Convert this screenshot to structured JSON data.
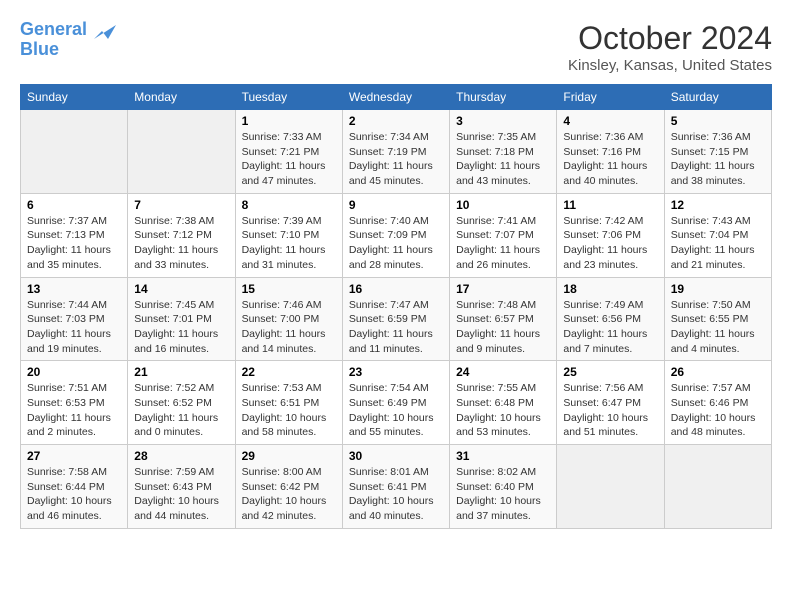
{
  "header": {
    "logo_line1": "General",
    "logo_line2": "Blue",
    "title": "October 2024",
    "subtitle": "Kinsley, Kansas, United States"
  },
  "days_of_week": [
    "Sunday",
    "Monday",
    "Tuesday",
    "Wednesday",
    "Thursday",
    "Friday",
    "Saturday"
  ],
  "weeks": [
    [
      {
        "day": "",
        "info": ""
      },
      {
        "day": "",
        "info": ""
      },
      {
        "day": "1",
        "info": "Sunrise: 7:33 AM\nSunset: 7:21 PM\nDaylight: 11 hours and 47 minutes."
      },
      {
        "day": "2",
        "info": "Sunrise: 7:34 AM\nSunset: 7:19 PM\nDaylight: 11 hours and 45 minutes."
      },
      {
        "day": "3",
        "info": "Sunrise: 7:35 AM\nSunset: 7:18 PM\nDaylight: 11 hours and 43 minutes."
      },
      {
        "day": "4",
        "info": "Sunrise: 7:36 AM\nSunset: 7:16 PM\nDaylight: 11 hours and 40 minutes."
      },
      {
        "day": "5",
        "info": "Sunrise: 7:36 AM\nSunset: 7:15 PM\nDaylight: 11 hours and 38 minutes."
      }
    ],
    [
      {
        "day": "6",
        "info": "Sunrise: 7:37 AM\nSunset: 7:13 PM\nDaylight: 11 hours and 35 minutes."
      },
      {
        "day": "7",
        "info": "Sunrise: 7:38 AM\nSunset: 7:12 PM\nDaylight: 11 hours and 33 minutes."
      },
      {
        "day": "8",
        "info": "Sunrise: 7:39 AM\nSunset: 7:10 PM\nDaylight: 11 hours and 31 minutes."
      },
      {
        "day": "9",
        "info": "Sunrise: 7:40 AM\nSunset: 7:09 PM\nDaylight: 11 hours and 28 minutes."
      },
      {
        "day": "10",
        "info": "Sunrise: 7:41 AM\nSunset: 7:07 PM\nDaylight: 11 hours and 26 minutes."
      },
      {
        "day": "11",
        "info": "Sunrise: 7:42 AM\nSunset: 7:06 PM\nDaylight: 11 hours and 23 minutes."
      },
      {
        "day": "12",
        "info": "Sunrise: 7:43 AM\nSunset: 7:04 PM\nDaylight: 11 hours and 21 minutes."
      }
    ],
    [
      {
        "day": "13",
        "info": "Sunrise: 7:44 AM\nSunset: 7:03 PM\nDaylight: 11 hours and 19 minutes."
      },
      {
        "day": "14",
        "info": "Sunrise: 7:45 AM\nSunset: 7:01 PM\nDaylight: 11 hours and 16 minutes."
      },
      {
        "day": "15",
        "info": "Sunrise: 7:46 AM\nSunset: 7:00 PM\nDaylight: 11 hours and 14 minutes."
      },
      {
        "day": "16",
        "info": "Sunrise: 7:47 AM\nSunset: 6:59 PM\nDaylight: 11 hours and 11 minutes."
      },
      {
        "day": "17",
        "info": "Sunrise: 7:48 AM\nSunset: 6:57 PM\nDaylight: 11 hours and 9 minutes."
      },
      {
        "day": "18",
        "info": "Sunrise: 7:49 AM\nSunset: 6:56 PM\nDaylight: 11 hours and 7 minutes."
      },
      {
        "day": "19",
        "info": "Sunrise: 7:50 AM\nSunset: 6:55 PM\nDaylight: 11 hours and 4 minutes."
      }
    ],
    [
      {
        "day": "20",
        "info": "Sunrise: 7:51 AM\nSunset: 6:53 PM\nDaylight: 11 hours and 2 minutes."
      },
      {
        "day": "21",
        "info": "Sunrise: 7:52 AM\nSunset: 6:52 PM\nDaylight: 11 hours and 0 minutes."
      },
      {
        "day": "22",
        "info": "Sunrise: 7:53 AM\nSunset: 6:51 PM\nDaylight: 10 hours and 58 minutes."
      },
      {
        "day": "23",
        "info": "Sunrise: 7:54 AM\nSunset: 6:49 PM\nDaylight: 10 hours and 55 minutes."
      },
      {
        "day": "24",
        "info": "Sunrise: 7:55 AM\nSunset: 6:48 PM\nDaylight: 10 hours and 53 minutes."
      },
      {
        "day": "25",
        "info": "Sunrise: 7:56 AM\nSunset: 6:47 PM\nDaylight: 10 hours and 51 minutes."
      },
      {
        "day": "26",
        "info": "Sunrise: 7:57 AM\nSunset: 6:46 PM\nDaylight: 10 hours and 48 minutes."
      }
    ],
    [
      {
        "day": "27",
        "info": "Sunrise: 7:58 AM\nSunset: 6:44 PM\nDaylight: 10 hours and 46 minutes."
      },
      {
        "day": "28",
        "info": "Sunrise: 7:59 AM\nSunset: 6:43 PM\nDaylight: 10 hours and 44 minutes."
      },
      {
        "day": "29",
        "info": "Sunrise: 8:00 AM\nSunset: 6:42 PM\nDaylight: 10 hours and 42 minutes."
      },
      {
        "day": "30",
        "info": "Sunrise: 8:01 AM\nSunset: 6:41 PM\nDaylight: 10 hours and 40 minutes."
      },
      {
        "day": "31",
        "info": "Sunrise: 8:02 AM\nSunset: 6:40 PM\nDaylight: 10 hours and 37 minutes."
      },
      {
        "day": "",
        "info": ""
      },
      {
        "day": "",
        "info": ""
      }
    ]
  ]
}
